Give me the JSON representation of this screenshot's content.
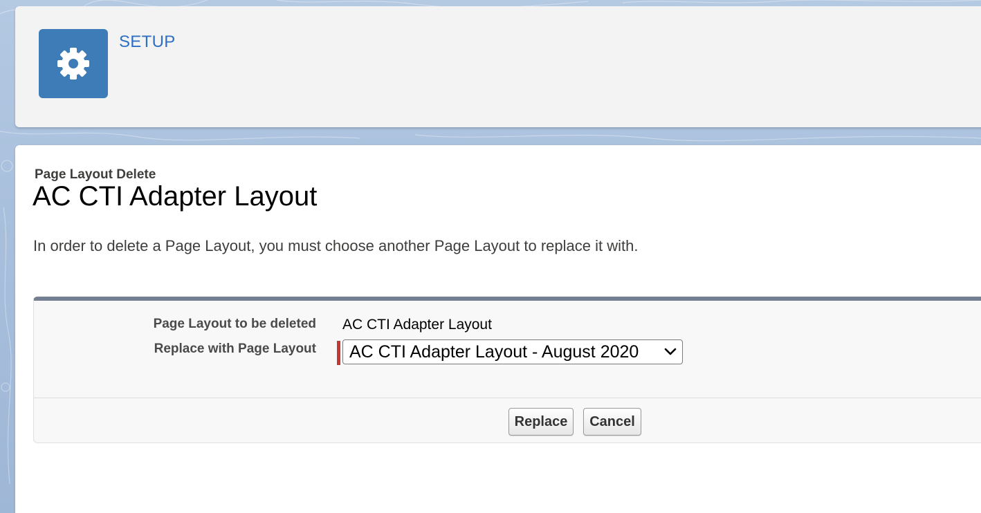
{
  "header": {
    "app_label": "SETUP",
    "icon": "gear-icon"
  },
  "page": {
    "eyebrow": "Page Layout Delete",
    "title": "AC CTI Adapter Layout",
    "instructions": "In order to delete a Page Layout, you must choose another Page Layout to replace it with."
  },
  "form": {
    "deleted_label": "Page Layout to be deleted",
    "deleted_value": "AC CTI Adapter Layout",
    "replace_label": "Replace with Page Layout",
    "replace_selected": "AC CTI Adapter Layout - August 2020",
    "required_color": "#c23934"
  },
  "actions": {
    "replace_label": "Replace",
    "cancel_label": "Cancel"
  },
  "colors": {
    "icon_bg": "#3d7cb6",
    "link_blue": "#2e6fc2",
    "block_border": "#747f92"
  }
}
